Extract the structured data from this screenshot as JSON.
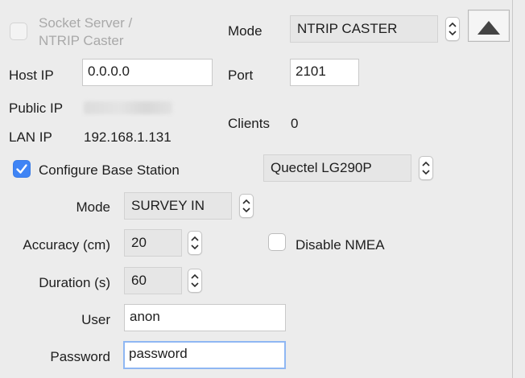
{
  "server": {
    "socket_label_line1": "Socket Server /",
    "socket_label_line2": "NTRIP Caster",
    "mode_label": "Mode",
    "mode_value": "NTRIP CASTER",
    "host_ip_label": "Host IP",
    "host_ip_value": "0.0.0.0",
    "port_label": "Port",
    "port_value": "2101",
    "public_ip_label": "Public IP",
    "lan_ip_label": "LAN IP",
    "lan_ip_value": "192.168.1.131",
    "clients_label": "Clients",
    "clients_value": "0"
  },
  "base": {
    "configure_label": "Configure Base Station",
    "configure_checked": true,
    "receiver_value": "Quectel LG290P",
    "mode_label": "Mode",
    "mode_value": "SURVEY IN",
    "accuracy_label": "Accuracy (cm)",
    "accuracy_value": "20",
    "disable_nmea_label": "Disable NMEA",
    "disable_nmea_checked": false,
    "duration_label": "Duration (s)",
    "duration_value": "60",
    "user_label": "User",
    "user_value": "anon",
    "password_label": "Password",
    "password_value": "password"
  },
  "colors": {
    "accent": "#3f84f5",
    "focus_ring": "#8fb7f3",
    "disabled_text": "#a9a9a9"
  }
}
